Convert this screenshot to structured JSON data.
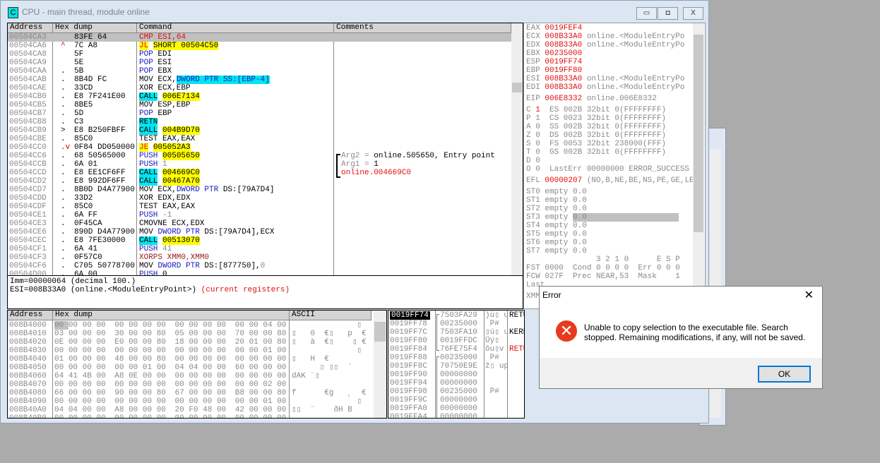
{
  "window": {
    "title": "CPU - main thread, module online",
    "icon_letter": "C",
    "min": "▭",
    "max": "◘",
    "close": "X"
  },
  "disasm": {
    "headers": [
      "Address",
      "Hex dump",
      "Command",
      "Comments"
    ],
    "rows": [
      {
        "addr": "00504CA3",
        "mark": "",
        "hex": "83FE 64",
        "cmd": [
          [
            "CMP ESI,",
            "red"
          ],
          [
            "64",
            "red"
          ]
        ],
        "selected": true
      },
      {
        "addr": "00504CA6",
        "mark": "^",
        "hex": "7C A8",
        "cmd": [
          [
            "JL",
            "jmp"
          ],
          [
            " ",
            ""
          ],
          [
            "SHORT 00504C50",
            "ybg"
          ]
        ]
      },
      {
        "addr": "00504CA8",
        "mark": "",
        "hex": "5F",
        "cmd": [
          [
            "POP",
            "blue"
          ],
          [
            " EDI",
            ""
          ]
        ]
      },
      {
        "addr": "00504CA9",
        "mark": "",
        "hex": "5E",
        "cmd": [
          [
            "POP",
            "blue"
          ],
          [
            " ESI",
            ""
          ]
        ]
      },
      {
        "addr": "00504CAA",
        "mark": ".",
        "hex": "5B",
        "cmd": [
          [
            "POP",
            "blue"
          ],
          [
            " EBX",
            ""
          ]
        ]
      },
      {
        "addr": "00504CAB",
        "mark": ".",
        "hex": "8B4D FC",
        "cmd": [
          [
            "MOV ECX,",
            ""
          ],
          [
            "DWORD PTR SS:[EBP-4]",
            "cbgb"
          ]
        ]
      },
      {
        "addr": "00504CAE",
        "mark": ".",
        "hex": "33CD",
        "cmd": [
          [
            "XOR ECX,EBP",
            ""
          ]
        ]
      },
      {
        "addr": "00504CB0",
        "mark": ".",
        "hex": "E8 7F241E00",
        "cmd": [
          [
            "CALL",
            "cbg"
          ],
          [
            " ",
            ""
          ],
          [
            "006E7134",
            "ybg"
          ]
        ]
      },
      {
        "addr": "00504CB5",
        "mark": ".",
        "hex": "8BE5",
        "cmd": [
          [
            "MOV ESP,EBP",
            ""
          ]
        ]
      },
      {
        "addr": "00504CB7",
        "mark": ".",
        "hex": "5D",
        "cmd": [
          [
            "POP",
            "blue"
          ],
          [
            " EBP",
            ""
          ]
        ]
      },
      {
        "addr": "00504CB8",
        "mark": ".",
        "hex": "C3",
        "cmd": [
          [
            "RETN",
            "cbg"
          ]
        ]
      },
      {
        "addr": "00504CB9",
        "mark": ">",
        "hex": "E8 B250FBFF",
        "cmd": [
          [
            "CALL",
            "cbg"
          ],
          [
            " ",
            ""
          ],
          [
            "004B9D70",
            "ybg"
          ]
        ]
      },
      {
        "addr": "00504CBE",
        "mark": ".",
        "hex": "85C0",
        "cmd": [
          [
            "TEST EAX,EAX",
            ""
          ]
        ]
      },
      {
        "addr": "00504CC0",
        "mark": ".v",
        "hex": "0F84 DD050000",
        "cmd": [
          [
            "JE",
            "jmp"
          ],
          [
            " ",
            ""
          ],
          [
            "005052A3",
            "ybg"
          ]
        ]
      },
      {
        "addr": "00504CC6",
        "mark": ".",
        "hex": "68 50565000",
        "cmd": [
          [
            "PUSH",
            "blue"
          ],
          [
            " ",
            ""
          ],
          [
            "00505650",
            "ybg"
          ]
        ]
      },
      {
        "addr": "00504CCB",
        "mark": ".",
        "hex": "6A 01",
        "cmd": [
          [
            "PUSH",
            "blue"
          ],
          [
            " ",
            ""
          ],
          [
            "1",
            "g"
          ]
        ]
      },
      {
        "addr": "00504CCD",
        "mark": ".",
        "hex": "E8 EE1CF6FF",
        "cmd": [
          [
            "CALL",
            "cbg"
          ],
          [
            " ",
            ""
          ],
          [
            "004669C0",
            "ybg"
          ]
        ]
      },
      {
        "addr": "00504CD2",
        "mark": ".",
        "hex": "E8 992DF6FF",
        "cmd": [
          [
            "CALL",
            "cbg"
          ],
          [
            " ",
            ""
          ],
          [
            "00467A70",
            "ybg"
          ]
        ]
      },
      {
        "addr": "00504CD7",
        "mark": ".",
        "hex": "8B0D D4A77900",
        "cmd": [
          [
            "MOV ECX,",
            ""
          ],
          [
            "DWORD PTR",
            "blue"
          ],
          [
            " DS:[79A7D4]",
            ""
          ]
        ]
      },
      {
        "addr": "00504CDD",
        "mark": ".",
        "hex": "33D2",
        "cmd": [
          [
            "XOR EDX,EDX",
            ""
          ]
        ]
      },
      {
        "addr": "00504CDF",
        "mark": ".",
        "hex": "85C0",
        "cmd": [
          [
            "TEST EAX,EAX",
            ""
          ]
        ]
      },
      {
        "addr": "00504CE1",
        "mark": ".",
        "hex": "6A FF",
        "cmd": [
          [
            "PUSH",
            "blue"
          ],
          [
            " ",
            ""
          ],
          [
            "-1",
            "g"
          ]
        ]
      },
      {
        "addr": "00504CE3",
        "mark": ".",
        "hex": "0F45CA",
        "cmd": [
          [
            "CMOVNE ECX,EDX",
            ""
          ]
        ]
      },
      {
        "addr": "00504CE6",
        "mark": ".",
        "hex": "890D D4A77900",
        "cmd": [
          [
            "MOV ",
            ""
          ],
          [
            "DWORD PTR",
            "blue"
          ],
          [
            " DS:[79A7D4],ECX",
            ""
          ]
        ]
      },
      {
        "addr": "00504CEC",
        "mark": ".",
        "hex": "E8 7FE30000",
        "cmd": [
          [
            "CALL",
            "cbg"
          ],
          [
            " ",
            ""
          ],
          [
            "00513070",
            "ybg"
          ]
        ]
      },
      {
        "addr": "00504CF1",
        "mark": ".",
        "hex": "6A 41",
        "cmd": [
          [
            "PUSH",
            "blue"
          ],
          [
            " ",
            ""
          ],
          [
            "41",
            "g"
          ]
        ]
      },
      {
        "addr": "00504CF3",
        "mark": ".",
        "hex": "0F57C0",
        "cmd": [
          [
            "XORPS XMM0,XMM0",
            "brown"
          ]
        ]
      },
      {
        "addr": "00504CF6",
        "mark": ".",
        "hex": "C705 50778700",
        "cmd": [
          [
            "MOV ",
            ""
          ],
          [
            "DWORD PTR",
            "blue"
          ],
          [
            " DS:[877750],",
            ""
          ],
          [
            "0",
            "g"
          ]
        ]
      },
      {
        "addr": "00504D00",
        "mark": ".",
        "hex": "6A 00",
        "cmd": [
          [
            "PUSH",
            "blue"
          ],
          [
            " 0",
            ""
          ]
        ]
      }
    ],
    "comments": [
      {
        "row": 14,
        "parts": [
          [
            "Arg2 = ",
            "g"
          ],
          [
            "online.505650, Entry point",
            ""
          ]
        ]
      },
      {
        "row": 15,
        "parts": [
          [
            "Arg1 = ",
            "g"
          ],
          [
            "1",
            ""
          ]
        ]
      },
      {
        "row": 16,
        "parts": [
          [
            "online.004669C0",
            "red"
          ]
        ]
      }
    ]
  },
  "info": {
    "line1": "Imm=00000064 (decimal 100.)",
    "line2a": "ESI=008B33A0 (online.<ModuleEntryPoint>)",
    "line2b": "(current registers)"
  },
  "registers": {
    "lines": [
      [
        [
          "EAX ",
          "g"
        ],
        [
          "0019FEF4",
          "red"
        ]
      ],
      [
        [
          "ECX ",
          "g"
        ],
        [
          "008B33A0",
          "red"
        ],
        [
          " online.<ModuleEntryPo",
          "g"
        ]
      ],
      [
        [
          "EDX ",
          "g"
        ],
        [
          "008B33A0",
          "red"
        ],
        [
          " online.<ModuleEntryPo",
          "g"
        ]
      ],
      [
        [
          "EBX ",
          "g"
        ],
        [
          "00235000",
          "red"
        ]
      ],
      [
        [
          "ESP ",
          "g"
        ],
        [
          "0019FF74",
          "red"
        ]
      ],
      [
        [
          "EBP ",
          "g"
        ],
        [
          "0019FF80",
          "red"
        ]
      ],
      [
        [
          "ESI ",
          "g"
        ],
        [
          "008B33A0",
          "red"
        ],
        [
          " online.<ModuleEntryPo",
          "g"
        ]
      ],
      [
        [
          "EDI ",
          "g"
        ],
        [
          "008B33A0",
          "red"
        ],
        [
          " online.<ModuleEntryPo",
          "g"
        ]
      ],
      null,
      [
        [
          "EIP ",
          "g"
        ],
        [
          "006E8332",
          "red"
        ],
        [
          " online.006E8332",
          "g"
        ]
      ],
      null,
      [
        [
          "C ",
          "g"
        ],
        [
          "1",
          "red"
        ],
        [
          "  ES 002B 32bit 0(FFFFFFFF)",
          "g"
        ]
      ],
      [
        [
          "P 1  CS 0023 32bit 0(FFFFFFFF)",
          "g"
        ]
      ],
      [
        [
          "A 0  SS 002B 32bit 0(FFFFFFFF)",
          "g"
        ]
      ],
      [
        [
          "Z 0  DS 002B 32bit 0(FFFFFFFF)",
          "g"
        ]
      ],
      [
        [
          "S 0  FS 0053 32bit 238000(FFF)",
          "g"
        ]
      ],
      [
        [
          "T 0  GS 002B 32bit 0(FFFFFFFF)",
          "g"
        ]
      ],
      [
        [
          "D 0",
          "g"
        ]
      ],
      [
        [
          "O 0  LastErr 00000000 ERROR_SUCCESS",
          "g"
        ]
      ],
      null,
      [
        [
          "EFL ",
          "g"
        ],
        [
          "00000207",
          "red"
        ],
        [
          " (NO,B,NE,BE,NS,PE,GE,LE)",
          "g"
        ]
      ],
      null,
      [
        [
          "ST0 empty 0.0",
          "g"
        ]
      ],
      [
        [
          "ST1 empty 0.0",
          "g"
        ]
      ],
      [
        [
          "ST2 empty 0.0",
          "g"
        ]
      ],
      [
        [
          "ST3 empty ",
          "g"
        ],
        [
          "0.0",
          "sel"
        ]
      ],
      [
        [
          "ST4 empty 0.0",
          "g"
        ]
      ],
      [
        [
          "ST5 empty 0.0",
          "g"
        ]
      ],
      [
        [
          "ST6 empty 0.0",
          "g"
        ]
      ],
      [
        [
          "ST7 empty 0.0",
          "g"
        ]
      ],
      [
        [
          "               3 2 1 0      E S P",
          "g"
        ]
      ],
      [
        [
          "FST 0000  Cond 0 0 0 0  Err 0 0 0",
          "g"
        ]
      ],
      [
        [
          "FCW 027F  Prec NEAR,53  Mask    1",
          "g"
        ]
      ],
      [
        [
          "Last",
          "g"
        ]
      ],
      null,
      [
        [
          "XMM",
          "g"
        ]
      ]
    ]
  },
  "dump": {
    "headers": [
      "Address",
      "Hex dump",
      "ASCII"
    ],
    "rows": [
      {
        "addr": "008B4000",
        "hex": "00 00 00 00 00 00 00 00 00 00 00 00 00 00 04 00",
        "ascii": "              ▯ "
      },
      {
        "addr": "008B4010",
        "hex": "03 00 00 00 30 00 00 80 05 00 00 00 70 00 00 80",
        "ascii": "▯   0  €▯   p  €"
      },
      {
        "addr": "008B4020",
        "hex": "0E 00 00 00 E0 00 00 80 18 00 00 00 20 01 00 80",
        "ascii": "▯   à  €▯    ▯ €"
      },
      {
        "addr": "008B4030",
        "hex": "00 00 00 00 00 00 00 00 00 00 00 00 00 00 01 00",
        "ascii": "              ▯ "
      },
      {
        "addr": "008B4040",
        "hex": "01 00 00 00 48 00 00 80 00 00 00 00 00 00 00 00",
        "ascii": "▯   H  €        "
      },
      {
        "addr": "008B4050",
        "hex": "00 00 00 00 00 00 01 00 04 04 00 00 60 00 00 00",
        "ascii": "      ▯ ▯▯  `   "
      },
      {
        "addr": "008B4060",
        "hex": "64 41 4B 00 A8 0E 00 00 00 00 00 00 00 00 00 00",
        "ascii": "dAK ¨▯          "
      },
      {
        "addr": "008B4070",
        "hex": "00 00 00 00 00 00 00 00 00 00 00 00 00 00 02 00",
        "ascii": "                "
      },
      {
        "addr": "008B4080",
        "hex": "66 00 00 00 90 00 00 80 67 00 00 00 B8 00 00 80",
        "ascii": "f      €g   ¸  €"
      },
      {
        "addr": "008B4090",
        "hex": "00 00 00 00 00 00 00 00 00 00 00 00 00 00 01 00",
        "ascii": "              ▯ "
      },
      {
        "addr": "008B40A0",
        "hex": "04 04 00 00 A8 00 00 00 20 F0 48 00 42 00 00 00",
        "ascii": "▯▯  ¨    ðH B   "
      },
      {
        "addr": "008B40B0",
        "hex": "00 00 00 00 00 00 00 00 00 00 00 00 00 00 00 00",
        "ascii": ""
      }
    ]
  },
  "stack": {
    "rows": [
      {
        "addr": "0019FF74",
        "val": "7503FA29",
        "ascii": ")ú▯ u",
        "comment": "RETURN",
        "ccls": ""
      },
      {
        "addr": "0019FF78",
        "val": "00235000",
        "ascii": " P#",
        "comment": "",
        "ccls": ""
      },
      {
        "addr": "0019FF7C",
        "val": "7503FA10",
        "ascii": "▯ú▯ u",
        "comment": "KERNEL",
        "ccls": ""
      },
      {
        "addr": "0019FF80",
        "val": "0019FFDC",
        "ascii": "Üÿ▯",
        "comment": "",
        "ccls": ""
      },
      {
        "addr": "0019FF84",
        "val": "76FE75F4",
        "ascii": "ôu▯v",
        "comment": "RETURN",
        "ccls": "red"
      },
      {
        "addr": "0019FF88",
        "val": "00235000",
        "ascii": " P#",
        "comment": "",
        "ccls": ""
      },
      {
        "addr": "0019FF8C",
        "val": "70750E9E",
        "ascii": "ž▯ up",
        "comment": "",
        "ccls": ""
      },
      {
        "addr": "0019FF90",
        "val": "00000000",
        "ascii": "",
        "comment": "",
        "ccls": ""
      },
      {
        "addr": "0019FF94",
        "val": "00000000",
        "ascii": "",
        "comment": "",
        "ccls": ""
      },
      {
        "addr": "0019FF98",
        "val": "00235000",
        "ascii": " P#",
        "comment": "",
        "ccls": ""
      },
      {
        "addr": "0019FF9C",
        "val": "00000000",
        "ascii": "",
        "comment": "",
        "ccls": ""
      },
      {
        "addr": "0019FFA0",
        "val": "00000000",
        "ascii": "",
        "comment": "",
        "ccls": ""
      },
      {
        "addr": "0019FFA4",
        "val": "00000000",
        "ascii": "",
        "comment": "",
        "ccls": ""
      }
    ]
  },
  "dialog": {
    "title": "Error",
    "message": "Unable to copy selection to the executable file. Search stopped. Remaining modifications, if any, will not be saved.",
    "ok": "OK",
    "close": "✕",
    "icon": "error-icon",
    "icon_color": "#e81123"
  }
}
